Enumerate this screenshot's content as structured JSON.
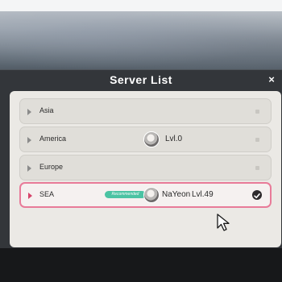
{
  "dialog": {
    "title": "Server List",
    "close_glyph": "×"
  },
  "servers": [
    {
      "name": "Asia",
      "selected": false
    },
    {
      "name": "America",
      "selected": false,
      "player": {
        "level": "Lvl.0"
      }
    },
    {
      "name": "Europe",
      "selected": false
    },
    {
      "name": "SEA",
      "selected": true,
      "badge": "Recommended",
      "player": {
        "name": "NaYeon",
        "level": "Lvl.49"
      }
    }
  ],
  "icons": {
    "close": "close-icon",
    "check": "check-circle-icon",
    "cursor": "mouse-pointer-icon",
    "avatar": "player-avatar"
  },
  "colors": {
    "selected_border": "#e87b99",
    "badge": "#4bc3a3",
    "panel": "#ebe9e5"
  }
}
